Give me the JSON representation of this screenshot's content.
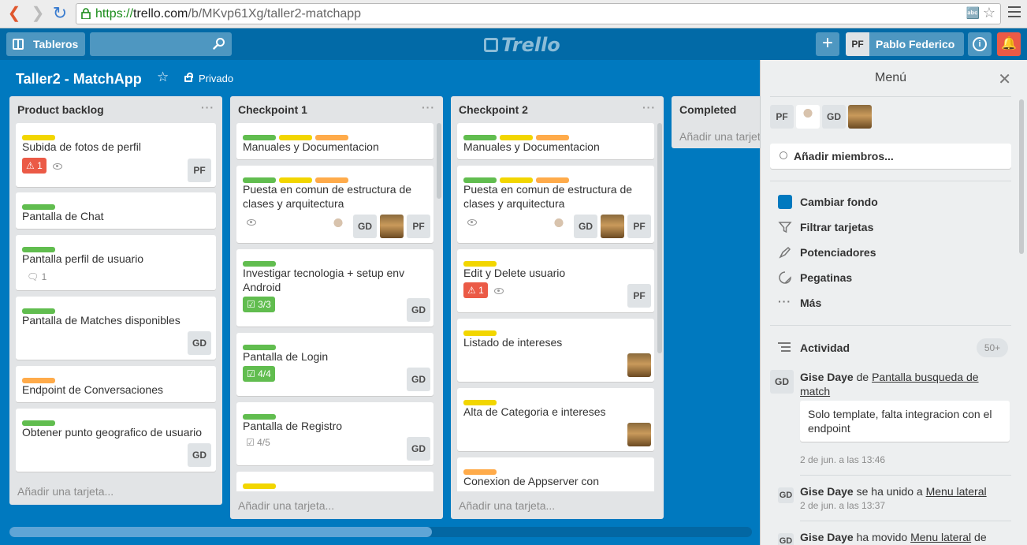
{
  "browser": {
    "url_https": "https://",
    "url_host": "trello.com",
    "url_path": "/b/MKvp61Xg/taller2-matchapp"
  },
  "header": {
    "boards_label": "Tableros",
    "search_placeholder": "",
    "logo_text": "Trello",
    "plus_label": "+",
    "user_initials": "PF",
    "user_name": "Pablo Federico"
  },
  "board": {
    "title": "Taller2 - MatchApp",
    "visibility": "Privado"
  },
  "lists": [
    {
      "title": "Product backlog",
      "add_card": "Añadir una tarjeta...",
      "cards": [
        {
          "title": "Subida de fotos de perfil",
          "alert_count": "1",
          "member": "PF"
        },
        {
          "title": "Pantalla de Chat"
        },
        {
          "title": "Pantalla perfil de usuario",
          "comments": "1"
        },
        {
          "title": "Pantalla de Matches disponibles",
          "member": "GD"
        },
        {
          "title": "Endpoint de Conversaciones"
        },
        {
          "title": "Obtener punto geografico de usuario",
          "member": "GD"
        }
      ]
    },
    {
      "title": "Checkpoint 1",
      "add_card": "Añadir una tarjeta...",
      "cards": [
        {
          "title": "Manuales y Documentacion"
        },
        {
          "title": "Puesta en comun de estructura de clases y arquitectura",
          "members": [
            "GD",
            "PF"
          ]
        },
        {
          "title": "Investigar tecnologia + setup env Android",
          "checklist": "3/3",
          "member": "GD"
        },
        {
          "title": "Pantalla de Login",
          "checklist": "4/4",
          "member": "GD"
        },
        {
          "title": "Pantalla de Registro",
          "checklist": "4/5",
          "member": "GD"
        }
      ]
    },
    {
      "title": "Checkpoint 2",
      "add_card": "Añadir una tarjeta...",
      "cards": [
        {
          "title": "Manuales y Documentacion"
        },
        {
          "title": "Puesta en comun de estructura de clases y arquitectura",
          "members": [
            "GD",
            "PF"
          ]
        },
        {
          "title": "Edit y Delete usuario",
          "alert_count": "1",
          "member": "PF"
        },
        {
          "title": "Listado de intereses"
        },
        {
          "title": "Alta de Categoria e intereses"
        },
        {
          "title": "Conexion de Appserver con"
        }
      ]
    },
    {
      "title": "Completed",
      "add_card": "Añadir una tarjeta..."
    }
  ],
  "menu": {
    "title": "Menú",
    "members": [
      "PF",
      "GD"
    ],
    "add_members": "Añadir miembros...",
    "items": [
      "Cambiar fondo",
      "Filtrar tarjetas",
      "Potenciadores",
      "Pegatinas",
      "Más"
    ],
    "activity_label": "Actividad",
    "activity_count": "50+",
    "activities": [
      {
        "initials": "GD",
        "user": "Gise Daye",
        "verb": "de",
        "target": "Pantalla busqueda de match",
        "comment": "Solo template, falta integracion con el endpoint",
        "time": "2 de jun. a las 13:46"
      },
      {
        "initials": "GD",
        "user": "Gise Daye",
        "verb": "se ha unido a",
        "target": "Menu lateral",
        "time": "2 de jun. a las 13:37"
      },
      {
        "initials": "GD",
        "user": "Gise Daye",
        "verb": "ha movido",
        "target": "Menu lateral",
        "tail": "de"
      }
    ]
  },
  "colors": {
    "board_bg": "#0079bf",
    "header_bg": "#026aa7",
    "label_green": "#61bd4f",
    "label_yellow": "#f2d600",
    "label_orange": "#ffab4a",
    "alert_red": "#eb5a46",
    "background_swatch": "#0079bf"
  }
}
